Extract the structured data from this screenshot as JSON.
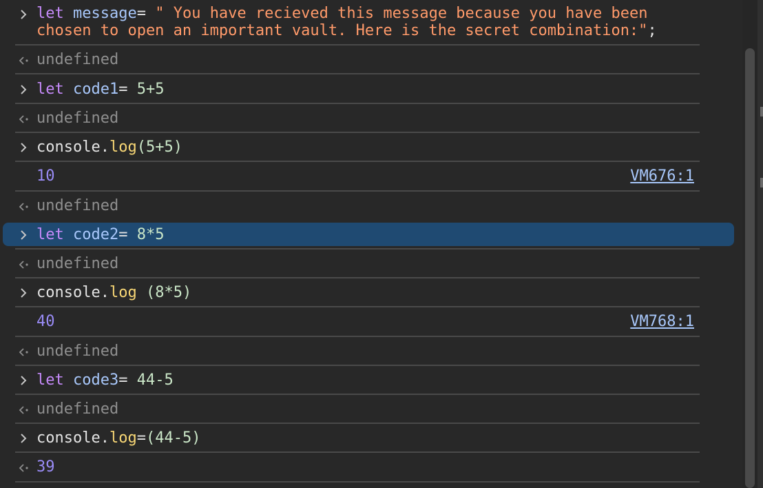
{
  "console": {
    "message_line1_kw": "let",
    "message_line1_var": "message",
    "message_line1_eq": "= ",
    "message_line1_str": "\" You have recieved this message because you have been",
    "message_line2_str": "chosen to open an important vault. Here is the secret combination:\"",
    "message_line2_end": ";",
    "undefined_label": "undefined",
    "code1_kw": "let",
    "code1_var": "code1",
    "code1_eq": "= ",
    "code1_val": "5+5",
    "log1_obj": "console.",
    "log1_fn": "log",
    "log1_args": "(5+5)",
    "log1_result": "10",
    "log1_source": "VM676:1",
    "code2_kw": "let",
    "code2_var": "code2",
    "code2_eq": "= ",
    "code2_val": "8*5",
    "log2_obj": "console.",
    "log2_fn": "log",
    "log2_args": " (8*5)",
    "log2_result": "40",
    "log2_source": "VM768:1",
    "code3_kw": "let",
    "code3_var": "code3",
    "code3_eq": "= ",
    "code3_val": "44-5",
    "log3_obj": "console.",
    "log3_fn": "log",
    "log3_eq": "=",
    "log3_args": "(44-5)",
    "log3_result": "39"
  },
  "icons": {
    "input_prompt": "chevron-right-icon",
    "output_return": "return-arrow-icon"
  },
  "colors": {
    "background": "#282828",
    "selection": "#1f4a72",
    "keyword": "#c58af9",
    "variable": "#a8c7fa",
    "number": "#cbe7c8",
    "string": "#ff9a6a",
    "function": "#f7d675",
    "result": "#9a8cf7",
    "undefined": "#8f8f8f"
  }
}
